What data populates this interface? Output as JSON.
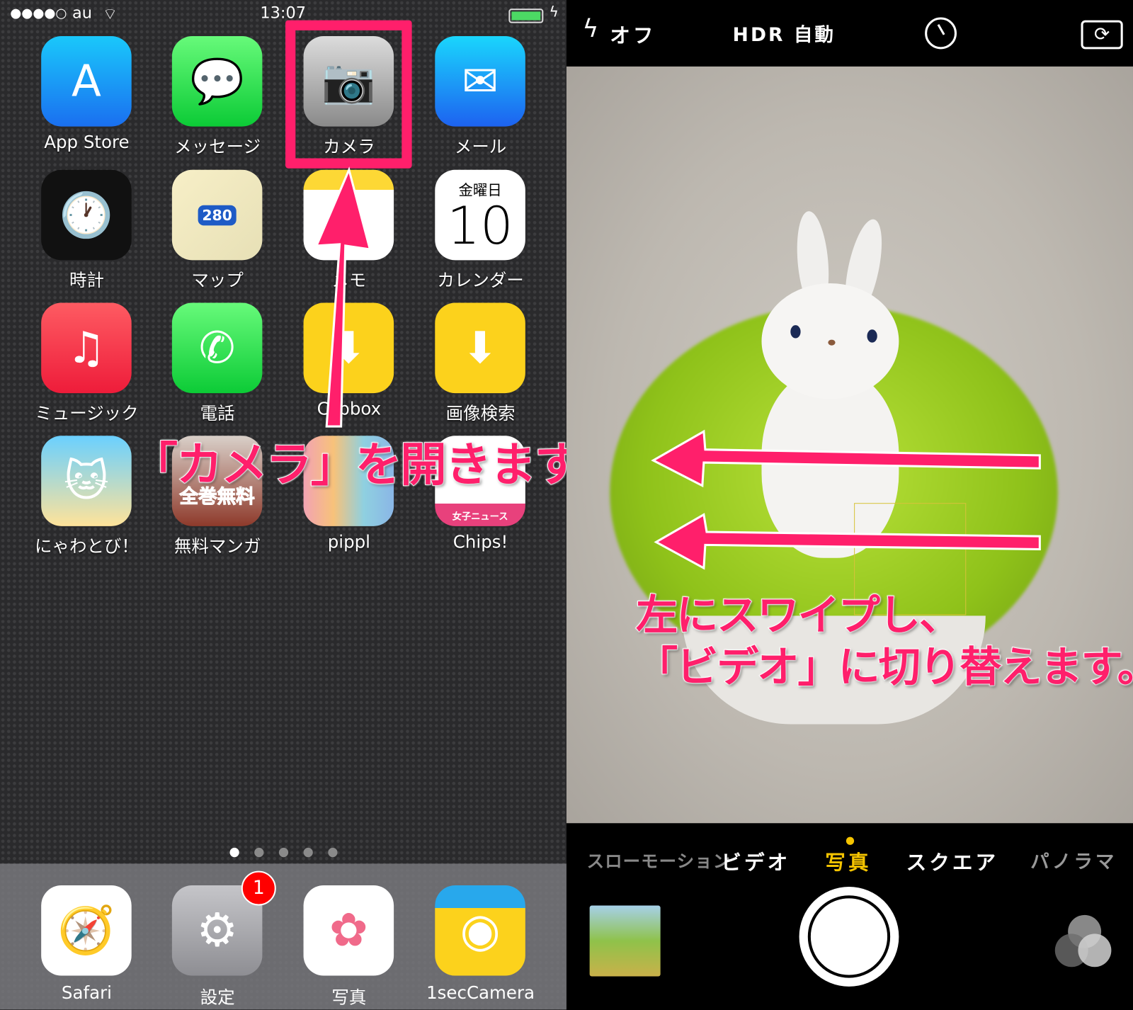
{
  "status_bar": {
    "carrier": "au",
    "time": "13:07",
    "signal_bars": 4,
    "battery_level": 1.0
  },
  "home": {
    "apps": [
      {
        "label": "App Store",
        "icon": "app-store-icon"
      },
      {
        "label": "メッセージ",
        "icon": "messages-icon"
      },
      {
        "label": "カメラ",
        "icon": "camera-icon"
      },
      {
        "label": "メール",
        "icon": "mail-icon"
      },
      {
        "label": "時計",
        "icon": "clock-icon"
      },
      {
        "label": "マップ",
        "icon": "maps-icon",
        "route": "280"
      },
      {
        "label": "メモ",
        "icon": "notes-icon"
      },
      {
        "label": "カレンダー",
        "icon": "calendar-icon",
        "weekday": "金曜日",
        "day": "10"
      },
      {
        "label": "ミュージック",
        "icon": "music-icon"
      },
      {
        "label": "電話",
        "icon": "phone-icon"
      },
      {
        "label": "Clipbox",
        "icon": "clipbox-icon"
      },
      {
        "label": "画像検索",
        "icon": "image-search-icon"
      },
      {
        "label": "にゃわとび！",
        "icon": "nyawatobi-icon"
      },
      {
        "label": "無料マンガ",
        "icon": "manga-icon",
        "banner": "全巻無料"
      },
      {
        "label": "pippl",
        "icon": "pippl-icon"
      },
      {
        "label": "Chips!",
        "icon": "chips-icon",
        "banner": "女子ニュース"
      }
    ],
    "page_count": 5,
    "current_page": 1,
    "dock": [
      {
        "label": "Safari",
        "icon": "safari-icon"
      },
      {
        "label": "設定",
        "icon": "settings-icon",
        "badge": "1"
      },
      {
        "label": "写真",
        "icon": "photos-icon"
      },
      {
        "label": "1secCamera",
        "icon": "1sec-camera-icon"
      }
    ]
  },
  "annotations": {
    "open_camera": "「カメラ」を開きます。",
    "swipe_line1": "左にスワイプし、",
    "swipe_line2": "「ビデオ」に切り替えます。",
    "color": "#ff1f6b"
  },
  "camera": {
    "flash": "オフ",
    "hdr": "HDR 自動",
    "modes": [
      "スローモーション",
      "ビデオ",
      "写真",
      "スクエア",
      "パノラマ"
    ],
    "active_mode": "写真",
    "active_color": "#f5c400"
  }
}
